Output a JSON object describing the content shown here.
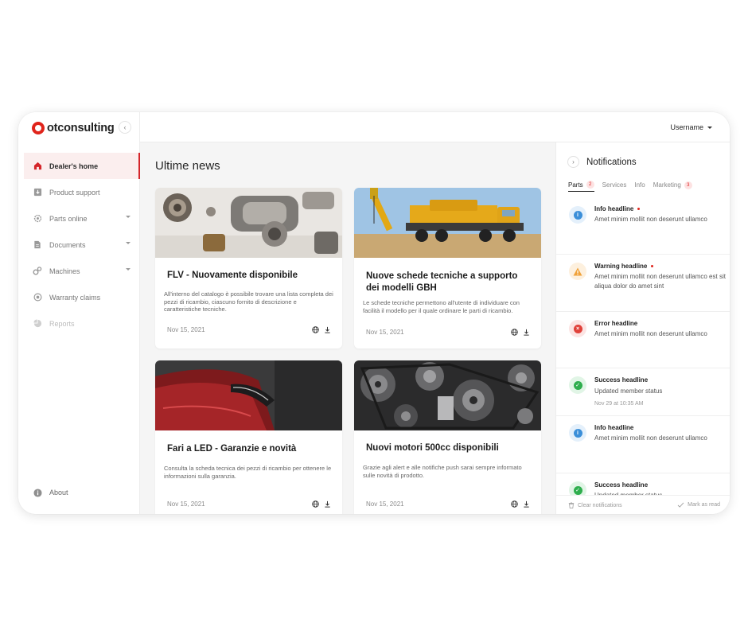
{
  "brand": {
    "name": "otconsulting",
    "accent": "#e0241b"
  },
  "sidebar": {
    "items": [
      {
        "label": "Dealer's home",
        "icon": "home-icon",
        "active": true
      },
      {
        "label": "Product support",
        "icon": "download-box-icon"
      },
      {
        "label": "Parts online",
        "icon": "gear-icon",
        "expandable": true
      },
      {
        "label": "Documents",
        "icon": "document-icon",
        "expandable": true
      },
      {
        "label": "Machines",
        "icon": "cogs-icon",
        "expandable": true
      },
      {
        "label": "Warranty claims",
        "icon": "target-icon"
      },
      {
        "label": "Reports",
        "icon": "pie-chart-icon",
        "disabled": true
      }
    ],
    "about": "About"
  },
  "topbar": {
    "username": "Username"
  },
  "main": {
    "title": "Ultime news",
    "cards": [
      {
        "title": "FLV - Nuovamente disponibile",
        "desc": "All'interno del catalogo è possibile trovare una lista completa dei pezzi di ricambio, ciascuno fornito di descrizione e caratteristiche tecniche.",
        "date": "Nov 15, 2021"
      },
      {
        "title": "Nuove schede tecniche a supporto dei modelli GBH",
        "desc": "Le schede tecniche permettono all'utente di individuare con facilità il modello per il quale ordinare le parti di ricambio.",
        "date": "Nov 15, 2021"
      },
      {
        "title": "Fari a LED -  Garanzie e novità",
        "desc": "Consulta la scheda tecnica dei pezzi di ricambio per ottenere le informazioni sulla garanzia.",
        "date": "Nov 15, 2021"
      },
      {
        "title": "Nuovi motori 500cc disponibili",
        "desc": "Grazie agli alert e alle notifiche push sarai sempre informato sulle novità di prodotto.",
        "date": "Nov 15, 2021"
      }
    ]
  },
  "notifications": {
    "title": "Notifications",
    "tabs": [
      {
        "label": "Parts",
        "badge": "2",
        "active": true
      },
      {
        "label": "Services"
      },
      {
        "label": "Info"
      },
      {
        "label": "Marketing",
        "badge": "3"
      }
    ],
    "items": [
      {
        "type": "info",
        "headline": "Info headline",
        "unread": true,
        "body": "Amet minim mollit non deserunt ullamco"
      },
      {
        "type": "warning",
        "headline": "Warning headline",
        "unread": true,
        "body": "Amet minim mollit non deserunt ullamco est sit aliqua dolor do amet sint"
      },
      {
        "type": "error",
        "headline": "Error headline",
        "body": "Amet minim mollit non deserunt ullamco"
      },
      {
        "type": "success",
        "headline": "Success headline",
        "body": "Updated member status",
        "time": "Nov 29 at 10:35 AM"
      },
      {
        "type": "info",
        "headline": "Info headline",
        "body": "Amet minim mollit non deserunt ullamco"
      },
      {
        "type": "success",
        "headline": "Success headline",
        "body": "Updated member status"
      }
    ],
    "clear_label": "Clear notifications",
    "mark_read_label": "Mark as read"
  },
  "colors": {
    "info": "#3b8fd9",
    "warning": "#f0a23b",
    "error": "#e0413a",
    "success": "#2fae4e"
  }
}
